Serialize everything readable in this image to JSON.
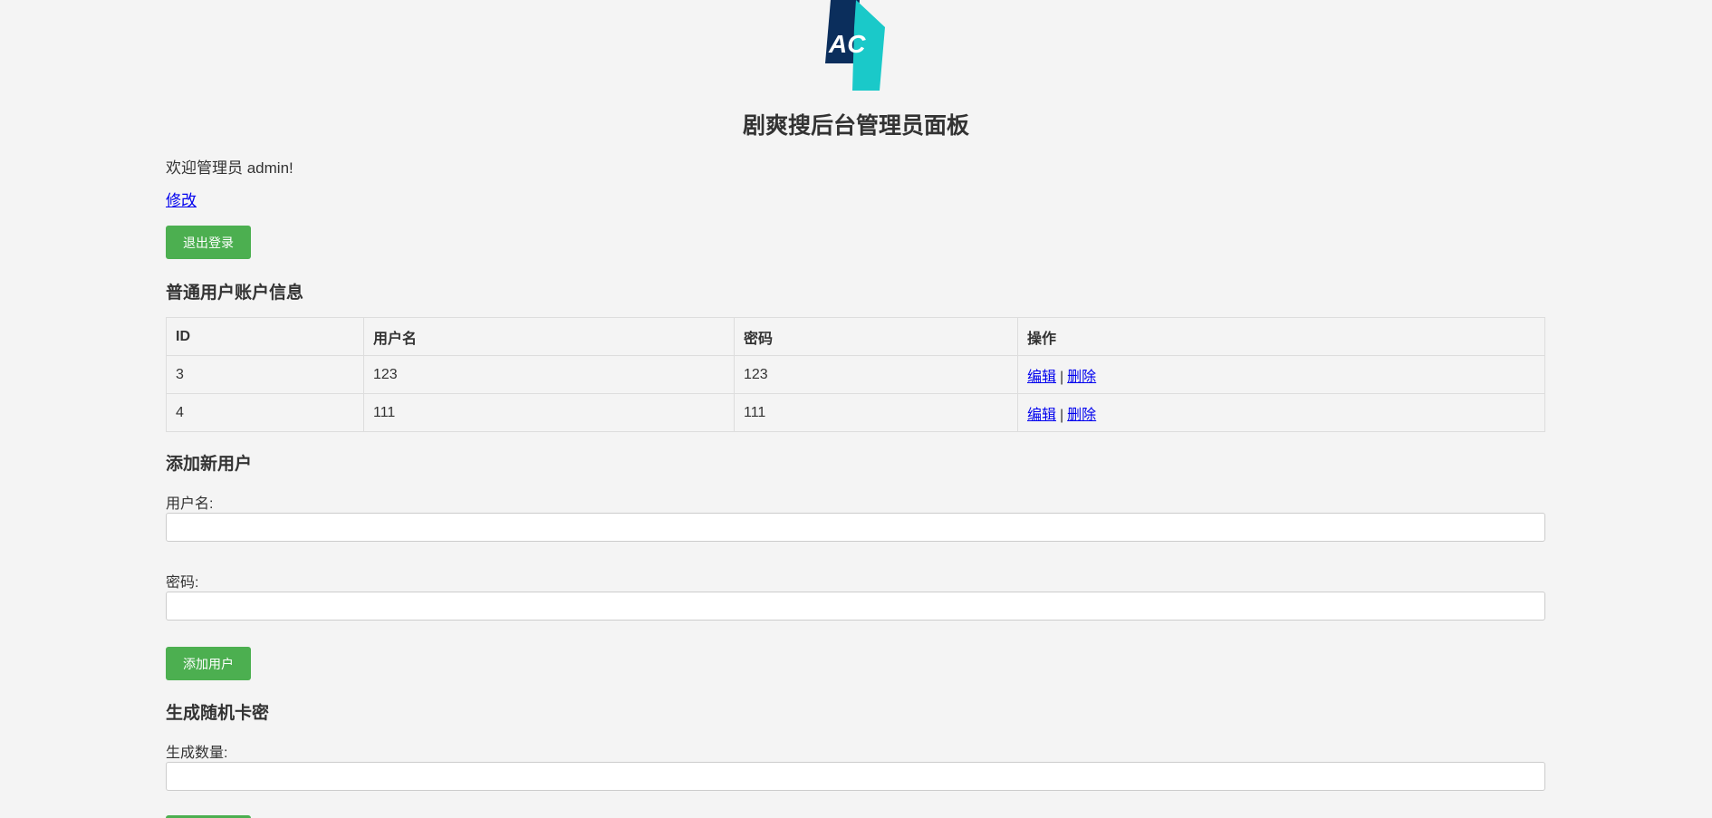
{
  "header": {
    "logo_text": "AC",
    "logo_small_text": "AC",
    "title": "剧爽搜后台管理员面板"
  },
  "welcome": {
    "text": "欢迎管理员 admin!",
    "modify_label": "修改",
    "logout_label": "退出登录"
  },
  "users_section": {
    "title": "普通用户账户信息",
    "columns": [
      "ID",
      "用户名",
      "密码",
      "操作"
    ],
    "rows": [
      {
        "id": "3",
        "username": "123",
        "password": "123",
        "edit": "编辑",
        "sep": "|",
        "delete": "删除"
      },
      {
        "id": "4",
        "username": "111",
        "password": "111",
        "edit": "编辑",
        "sep": "|",
        "delete": "删除"
      }
    ]
  },
  "add_user": {
    "title": "添加新用户",
    "username_label": "用户名:",
    "username_value": "",
    "password_label": "密码:",
    "password_value": "",
    "submit_label": "添加用户"
  },
  "card_keys": {
    "title": "生成随机卡密",
    "count_label": "生成数量:",
    "count_value": ""
  },
  "colors": {
    "primary_button": "#4caf50",
    "link": "#0000ee",
    "logo_dark": "#0b2e5c",
    "logo_cyan": "#1ac9c9"
  }
}
